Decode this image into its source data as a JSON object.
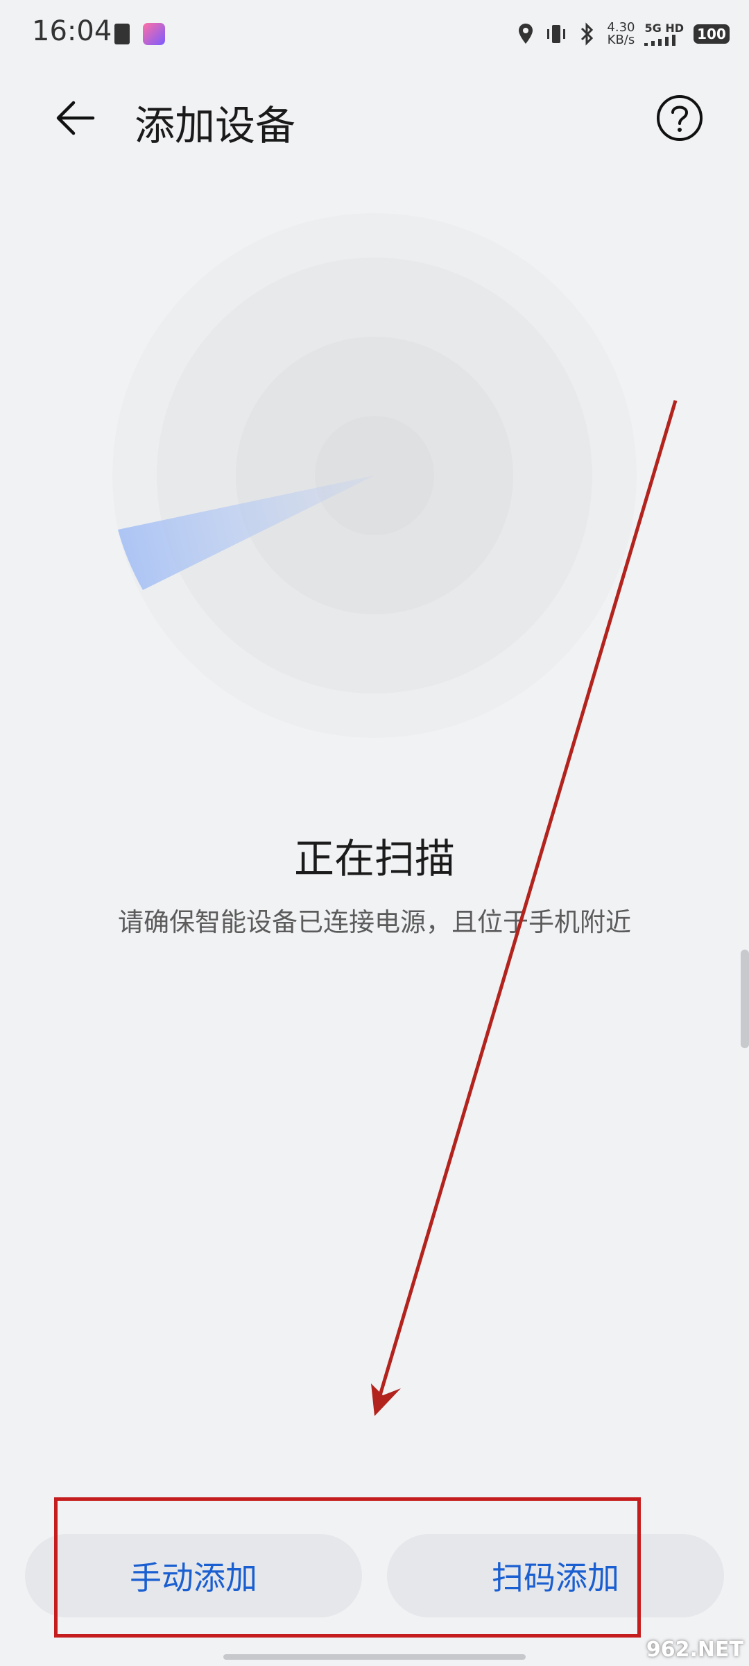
{
  "status_bar": {
    "time": "16:04",
    "speed": "4.30",
    "speed_unit": "KB/s",
    "network": "5G HD",
    "battery": "100",
    "icons": [
      "clipboard-icon",
      "app-icon",
      "location-icon",
      "vibrate-icon",
      "bluetooth-icon",
      "signal-icon"
    ]
  },
  "header": {
    "back_icon": "back-arrow-icon",
    "title": "添加设备",
    "help_icon": "help-icon"
  },
  "main": {
    "scan_title": "正在扫描",
    "scan_subtitle": "请确保智能设备已连接电源，且位于手机附近"
  },
  "buttons": {
    "manual": "手动添加",
    "scan": "扫码添加"
  },
  "watermark": "962.NET",
  "colors": {
    "accent": "#1a5fd1",
    "background": "#f1f2f4",
    "annotation": "#c51d1d"
  }
}
